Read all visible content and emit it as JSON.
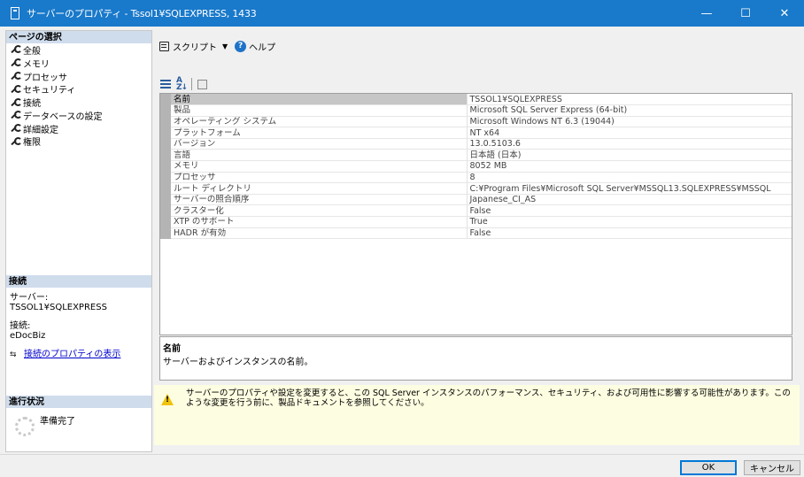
{
  "window": {
    "title": "サーバーのプロパティ - Tssol1¥SQLEXPRESS, 1433",
    "minimize": "—",
    "maximize": "☐",
    "close": "✕"
  },
  "sidebar": {
    "pages_header": "ページの選択",
    "pages": [
      {
        "label": "全般"
      },
      {
        "label": "メモリ"
      },
      {
        "label": "プロセッサ"
      },
      {
        "label": "セキュリティ"
      },
      {
        "label": "接続"
      },
      {
        "label": "データベースの設定"
      },
      {
        "label": "詳細設定"
      },
      {
        "label": "権限"
      }
    ],
    "connection_header": "接続",
    "server_label": "サーバー:",
    "server_value": "TSSOL1¥SQLEXPRESS",
    "connection_label": "接続:",
    "connection_value": "eDocBiz",
    "view_connection_link": "接続のプロパティの表示",
    "progress_header": "進行状況",
    "progress_status": "準備完了"
  },
  "toolbar": {
    "script_label": "スクリプト",
    "help_label": "ヘルプ"
  },
  "properties": [
    {
      "name": "名前",
      "value": "TSSOL1¥SQLEXPRESS"
    },
    {
      "name": "製品",
      "value": "Microsoft SQL Server Express (64-bit)"
    },
    {
      "name": "オペレーティング システム",
      "value": "Microsoft Windows NT 6.3 (19044)"
    },
    {
      "name": "プラットフォーム",
      "value": "NT x64"
    },
    {
      "name": "バージョン",
      "value": "13.0.5103.6"
    },
    {
      "name": "言語",
      "value": "日本語 (日本)"
    },
    {
      "name": "メモリ",
      "value": "8052 MB"
    },
    {
      "name": "プロセッサ",
      "value": "8"
    },
    {
      "name": "ルート ディレクトリ",
      "value": "C:¥Program Files¥Microsoft SQL Server¥MSSQL13.SQLEXPRESS¥MSSQL"
    },
    {
      "name": "サーバーの照合順序",
      "value": "Japanese_CI_AS"
    },
    {
      "name": "クラスター化",
      "value": "False"
    },
    {
      "name": "XTP のサポート",
      "value": "True"
    },
    {
      "name": "HADR が有効",
      "value": "False"
    }
  ],
  "description": {
    "title": "名前",
    "text": "サーバーおよびインスタンスの名前。"
  },
  "warning": {
    "text": "サーバーのプロパティや設定を変更すると、この SQL Server インスタンスのパフォーマンス、セキュリティ、および可用性に影響する可能性があります。このような変更を行う前に、製品ドキュメントを参照してください。"
  },
  "buttons": {
    "ok": "OK",
    "cancel": "キャンセル"
  },
  "colors": {
    "titlebar": "#1979ca",
    "section_header": "#cfdcec",
    "warning_bg": "#fdfde1",
    "link": "#0000cc"
  }
}
